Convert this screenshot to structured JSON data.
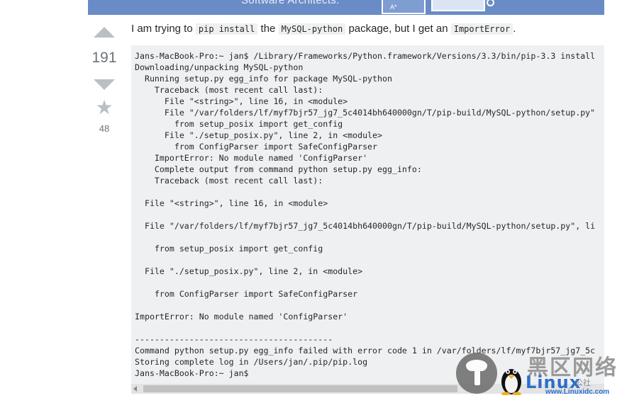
{
  "banner": {
    "text": "Software Architects.",
    "art_label": "A*"
  },
  "vote": {
    "count": "191",
    "favorites": "48"
  },
  "question": {
    "intro": "I am trying to",
    "cmd": "pip install",
    "mid": "the",
    "pkg": "MySQL-python",
    "post": "package, but I get an",
    "err": "ImportError",
    "end": "."
  },
  "code": {
    "lines": [
      "Jans-MacBook-Pro:~ jan$ /Library/Frameworks/Python.framework/Versions/3.3/bin/pip-3.3 install",
      "Downloading/unpacking MySQL-python",
      "  Running setup.py egg_info for package MySQL-python",
      "    Traceback (most recent call last):",
      "      File \"<string>\", line 16, in <module>",
      "      File \"/var/folders/lf/myf7bjr57_jg7_5c4014bh640000gn/T/pip-build/MySQL-python/setup.py\"",
      "        from setup_posix import get_config",
      "      File \"./setup_posix.py\", line 2, in <module>",
      "        from ConfigParser import SafeConfigParser",
      "    ImportError: No module named 'ConfigParser'",
      "    Complete output from command python setup.py egg_info:",
      "    Traceback (most recent call last):",
      "",
      "  File \"<string>\", line 16, in <module>",
      "",
      "  File \"/var/folders/lf/myf7bjr57_jg7_5c4014bh640000gn/T/pip-build/MySQL-python/setup.py\", li",
      "",
      "    from setup_posix import get_config",
      "",
      "  File \"./setup_posix.py\", line 2, in <module>",
      "",
      "    from ConfigParser import SafeConfigParser",
      "",
      "ImportError: No module named 'ConfigParser'",
      "",
      "----------------------------------------",
      "Command python setup.py egg_info failed with error code 1 in /var/folders/lf/myf7bjr57_jg7_5c",
      "Storing complete log in /Users/jan/.pip/pip.log",
      "Jans-MacBook-Pro:~ jan$"
    ]
  },
  "watermark": {
    "top": "黑区网络",
    "brand": "Linux",
    "sub": "公社",
    "url": "www.Linuxidc.com"
  }
}
